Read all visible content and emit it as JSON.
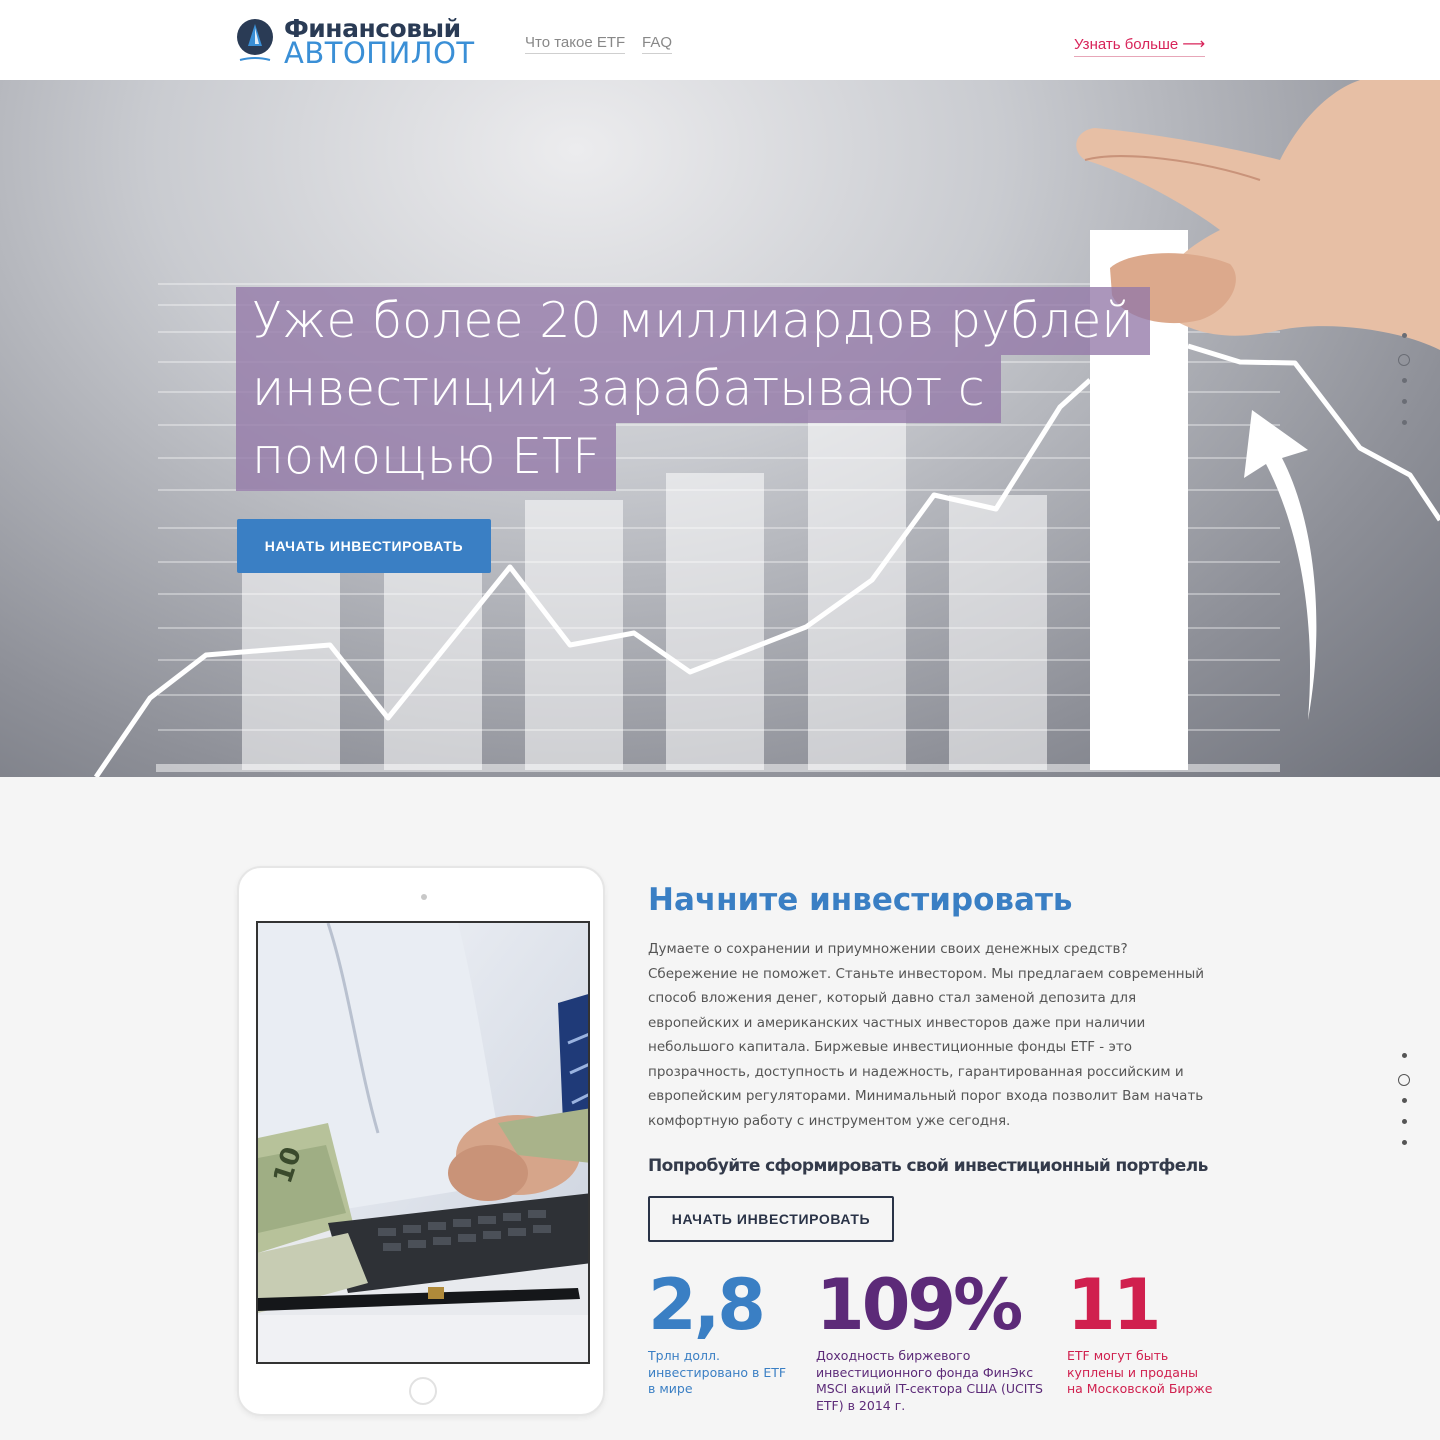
{
  "header": {
    "logo_line1": "Финансовый",
    "logo_line2": "АВТОПИЛОТ",
    "nav": [
      "Что такое ETF",
      "FAQ"
    ],
    "more_label": "Узнать больше",
    "more_arrow": "⟶"
  },
  "hero": {
    "headline_lines": [
      "Уже более 20 миллиардов рублей",
      "инвестиций зарабатывают с",
      "помощью ETF"
    ],
    "cta_label": "НАЧАТЬ ИНВЕСТИРОВАТЬ"
  },
  "main": {
    "title": "Начните инвестировать",
    "text": "Думаете о сохранении и приумножении своих денежных средств? Сбережение не поможет. Станьте инвестором. Мы предлагаем современный способ вложения денег, который давно стал заменой депозита для европейских и американских частных инвесторов даже при наличии небольшого капитала. Биржевые инвестиционные фонды ETF - это прозрачность, доступность и надежность, гарантированная российским и европейским регуляторами. Минимальный порог входа позволит Вам начать комфортную работу с инструментом уже сегодня.",
    "subtitle": "Попробуйте сформировать свой инвестиционный портфель",
    "cta_label": "НАЧАТЬ ИНВЕСТИРОВАТЬ"
  },
  "stats": [
    {
      "number": "2,8",
      "desc": "Трлн долл.\nинвестировано в ETF\nв мире",
      "color": "#3a7fc4"
    },
    {
      "number": "109%",
      "desc": "Доходность биржевого\nинвестиционного фонда ФинЭкс\nMSCI акций IT-сектора США (UCITS\nETF) в 2014 г.",
      "color": "#5c2a78"
    },
    {
      "number": "11",
      "desc": "ETF могут быть\nкуплены и проданы\nна Московской Бирже",
      "color": "#d0204e"
    }
  ],
  "colors": {
    "accent_blue": "#3a7fc4",
    "accent_purple": "#5c2a78",
    "accent_red": "#d0204e",
    "headline_bg": "#9478a8"
  },
  "icons": {
    "logo": "sailboat-logo-icon",
    "arrow": "arrow-right-icon",
    "home_button": "tablet-home-button-icon"
  },
  "images": {
    "hero": "hand placing bar on growth chart",
    "tablet": "businessman counting money at desk with calculator"
  }
}
